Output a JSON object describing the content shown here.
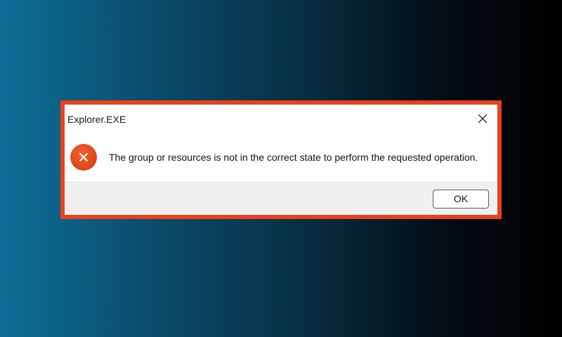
{
  "dialog": {
    "title": "Explorer.EXE",
    "message": "The group or resources is not in the correct state to perform the requested operation.",
    "icon": "error-icon",
    "close_icon": "close-icon",
    "ok_label": "OK"
  },
  "colors": {
    "highlight_border": "#e8411b",
    "error_icon": "#e04a1a",
    "background_left": "#0d6e97",
    "background_right": "#000000",
    "button_bar": "#f0f0f0"
  }
}
